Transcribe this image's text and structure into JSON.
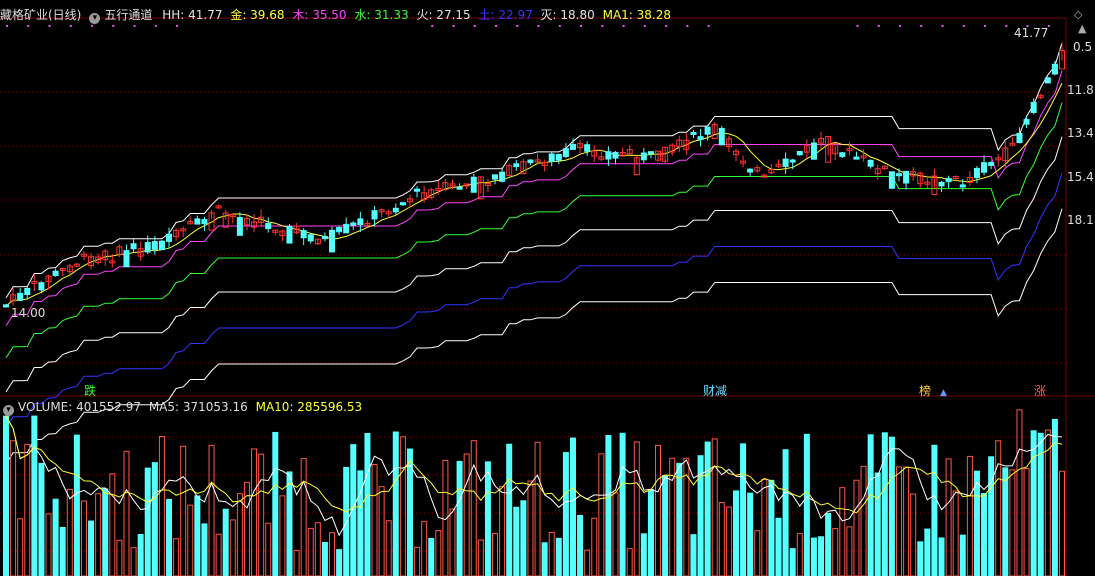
{
  "main_panel": {
    "stock_title": "藏格矿业(日线)",
    "indicator_name": "五行通道",
    "legend": [
      {
        "label": "HH: 41.77",
        "color": "#e0e0e0"
      },
      {
        "label": "金: 39.68",
        "color": "#ffff33"
      },
      {
        "label": "木: 35.50",
        "color": "#ff44ff"
      },
      {
        "label": "水: 31.33",
        "color": "#33ff33"
      },
      {
        "label": "火: 27.15",
        "color": "#e0e0e0"
      },
      {
        "label": "土: 22.97",
        "color": "#3333ff"
      },
      {
        "label": "灭: 18.80",
        "color": "#e0e0e0"
      },
      {
        "label": "MA1: 38.28",
        "color": "#ffff33"
      }
    ],
    "price_labels": {
      "high": "41.77",
      "low": "14.00"
    },
    "right_axis": [
      "0.5",
      "11.8",
      "13.4",
      "15.4",
      "18.1"
    ],
    "event_labels": [
      {
        "text": "跌",
        "color": "#33ff33"
      },
      {
        "text": "财减",
        "color": "#66ddff"
      },
      {
        "text": "榜",
        "color": "#ffcc33"
      },
      {
        "text": "涨",
        "color": "#ff5555"
      }
    ]
  },
  "volume_panel": {
    "legend": [
      {
        "label": "VOLUME: 401552.97",
        "color": "#dddddd"
      },
      {
        "label": "MA5: 371053.16",
        "color": "#dddddd"
      },
      {
        "label": "MA10: 285596.53",
        "color": "#ffff33"
      }
    ]
  },
  "colors": {
    "up": "#ff3333",
    "down": "#55ffff",
    "vol_up": "#ff5544",
    "vol_down": "#55ffff",
    "grid": "#7a0000",
    "hh": "#ffffff",
    "jin": "#ffff33",
    "mu": "#ff44ff",
    "shui": "#33ff33",
    "huo": "#ffffff",
    "tu": "#3333ff",
    "mie": "#ffffff"
  }
}
